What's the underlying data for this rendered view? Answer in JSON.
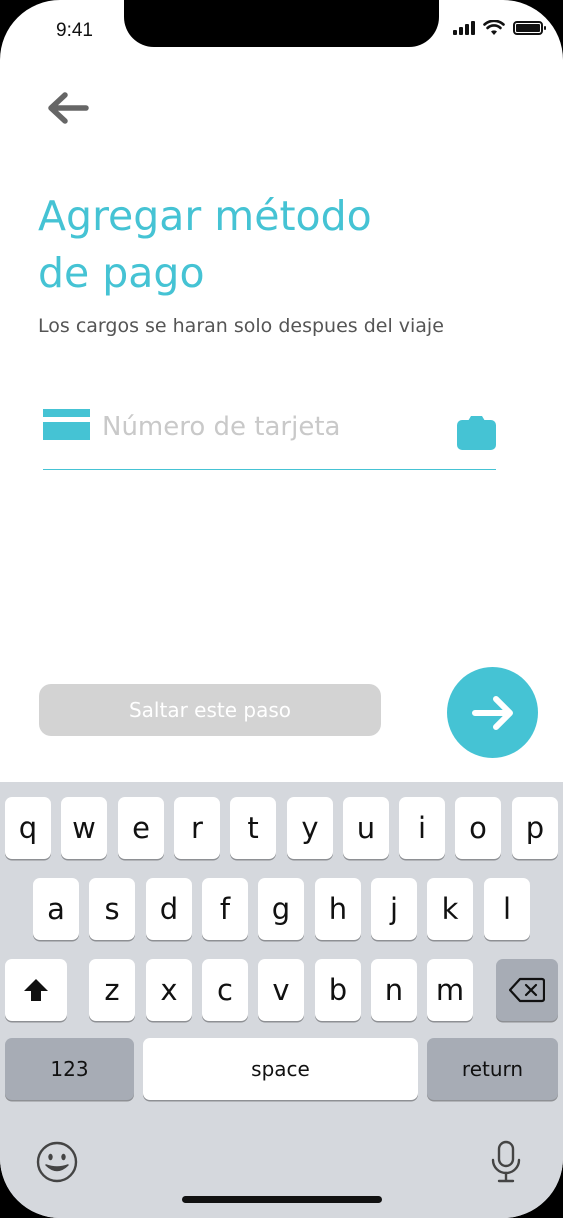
{
  "status_bar": {
    "time": "9:41"
  },
  "screen": {
    "title_line1": "Agregar método",
    "title_line2": "de pago",
    "subtitle": "Los cargos se haran solo despues del viaje",
    "card_field": {
      "placeholder": "Número de tarjeta",
      "value": ""
    },
    "skip_label": "Saltar este paso"
  },
  "keyboard": {
    "row1": [
      "q",
      "w",
      "e",
      "r",
      "t",
      "y",
      "u",
      "i",
      "o",
      "p"
    ],
    "row2": [
      "a",
      "s",
      "d",
      "f",
      "g",
      "h",
      "j",
      "k",
      "l"
    ],
    "row3": [
      "z",
      "x",
      "c",
      "v",
      "b",
      "n",
      "m"
    ],
    "numbers_label": "123",
    "space_label": "space",
    "return_label": "return"
  },
  "colors": {
    "accent": "#45C3D4",
    "skip_button": "#D3D3D3",
    "keyboard_bg": "#D5D8DD",
    "dark_key": "#A7ACB5"
  },
  "icons": [
    "back-arrow-icon",
    "card-icon",
    "camera-icon",
    "arrow-right-icon",
    "shift-icon",
    "backspace-icon",
    "emoji-icon",
    "microphone-icon"
  ]
}
